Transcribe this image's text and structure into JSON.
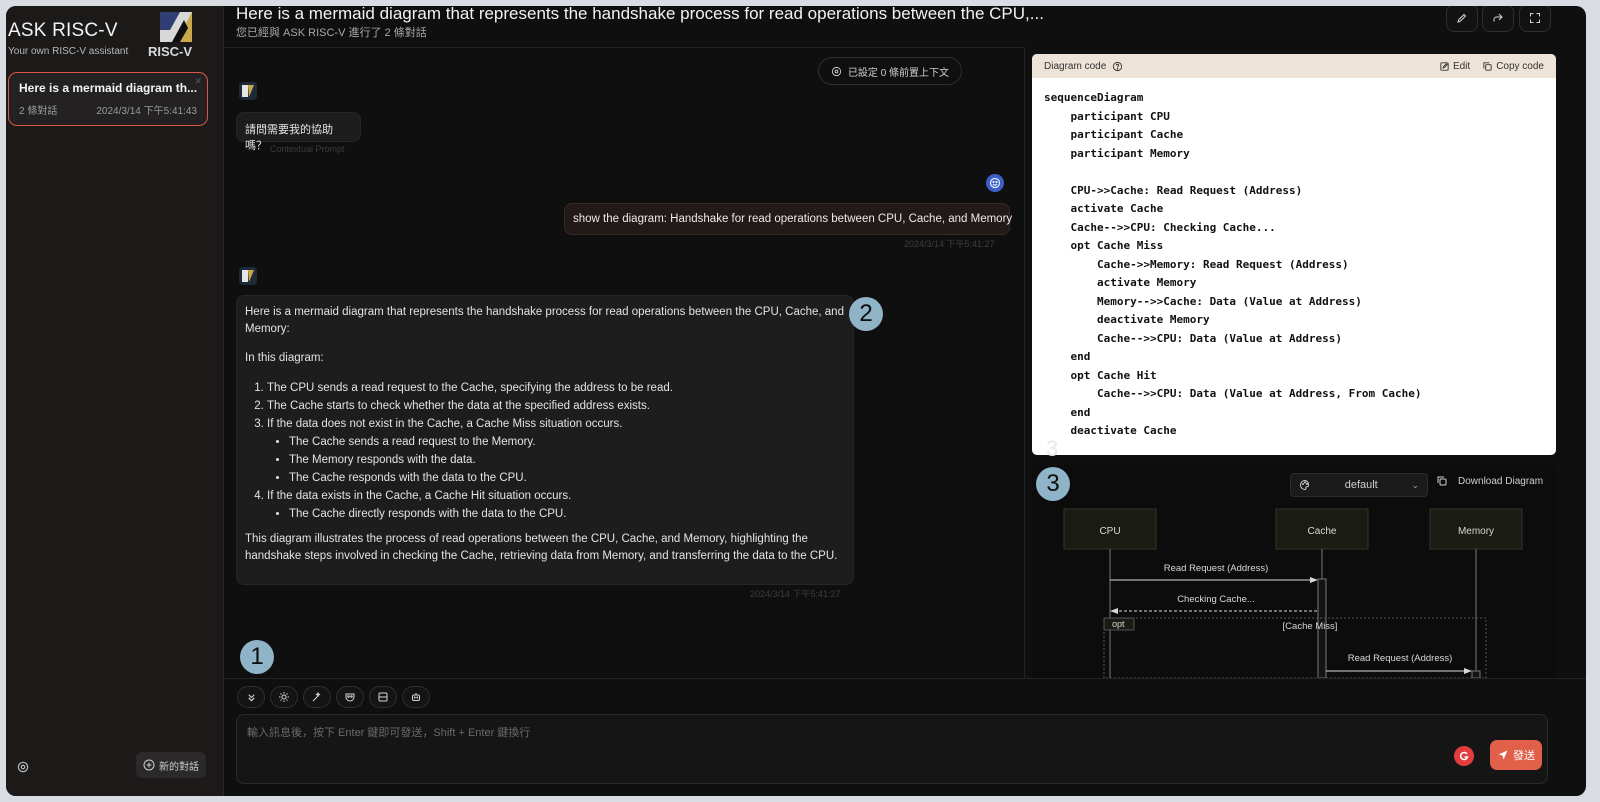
{
  "sidebar": {
    "brand_title": "ASK RISC-V",
    "brand_subtitle": "Your own RISC-V assistant",
    "logo_text": "RISC-V",
    "chat_item": {
      "title": "Here is a mermaid diagram th...",
      "count": "2 條對話",
      "timestamp": "2024/3/14 下午5:41:43"
    },
    "new_chat_label": "新的對話"
  },
  "header": {
    "title": "Here is a mermaid diagram that represents the handshake process for read operations between the CPU,...",
    "subtitle": "您已經與 ASK RISC-V 進行了 2 條對話"
  },
  "context_pill": "已設定 0 條前置上下文",
  "messages": {
    "bot_greeting": "請問需要我的協助嗎？",
    "contextual_prompt_label": "Contextual Prompt",
    "user_message": "show the diagram: Handshake for read operations between CPU, Cache, and Memory",
    "user_timestamp": "2024/3/14 下午5:41:27",
    "bot_reply": {
      "intro": "Here is a mermaid diagram that represents the handshake process for read operations between the CPU, Cache, and Memory:",
      "in_this": "In this diagram:",
      "step1": "The CPU sends a read request to the Cache, specifying the address to be read.",
      "step2": "The Cache starts to check whether the data at the specified address exists.",
      "step3": "If the data does not exist in the Cache, a Cache Miss situation occurs.",
      "step3a": "The Cache sends a read request to the Memory.",
      "step3b": "The Memory responds with the data.",
      "step3c": "The Cache responds with the data to the CPU.",
      "step4": "If the data exists in the Cache, a Cache Hit situation occurs.",
      "step4a": "The Cache directly responds with the data to the CPU.",
      "summary": "This diagram illustrates the process of read operations between the CPU, Cache, and Memory, highlighting the handshake steps involved in checking the Cache, retrieving data from Memory, and transferring the data to the CPU."
    },
    "bot_timestamp": "2024/3/14 下午5:41:27"
  },
  "badges": {
    "one": "1",
    "two": "2",
    "three": "3",
    "stray": "3"
  },
  "input": {
    "placeholder": "輸入訊息後，按下 Enter 鍵即可發送，Shift + Enter 鍵換行",
    "send_label": "發送"
  },
  "code_panel": {
    "header": "Diagram code",
    "edit_label": "Edit",
    "copy_label": "Copy code",
    "code": "sequenceDiagram\n    participant CPU\n    participant Cache\n    participant Memory\n\n    CPU->>Cache: Read Request (Address)\n    activate Cache\n    Cache-->>CPU: Checking Cache...\n    opt Cache Miss\n        Cache->>Memory: Read Request (Address)\n        activate Memory\n        Memory-->>Cache: Data (Value at Address)\n        deactivate Memory\n        Cache-->>CPU: Data (Value at Address)\n    end\n    opt Cache Hit\n        Cache-->>CPU: Data (Value at Address, From Cache)\n    end\n    deactivate Cache"
  },
  "diagram_panel": {
    "theme_value": "default",
    "download_label": "Download Diagram",
    "participants": [
      "CPU",
      "Cache",
      "Memory"
    ],
    "msg1": "Read Request (Address)",
    "msg2": "Checking Cache...",
    "opt_label": "opt",
    "opt_condition": "[Cache Miss]",
    "msg3": "Read Request (Address)"
  },
  "colors": {
    "accent": "#e0604a",
    "badge": "#8fb3c7",
    "chat_border": "#d9574a"
  }
}
